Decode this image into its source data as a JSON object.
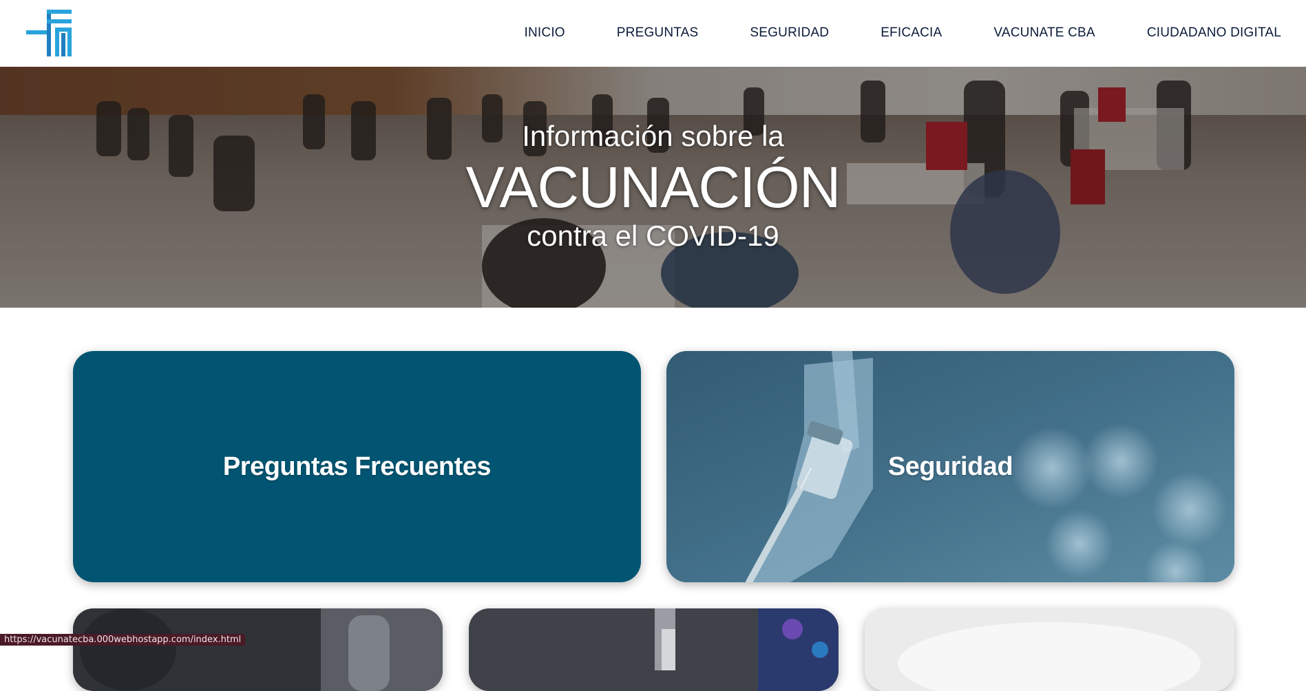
{
  "header": {
    "logo_name": "cf-monogram-logo",
    "logo_color": "#29a3dc",
    "nav": [
      {
        "label": "INICIO"
      },
      {
        "label": "PREGUNTAS"
      },
      {
        "label": "SEGURIDAD"
      },
      {
        "label": "EFICACIA"
      },
      {
        "label": "VACUNATE CBA"
      },
      {
        "label": "CIUDADANO DIGITAL"
      }
    ]
  },
  "hero": {
    "line1": "Información sobre la",
    "line2": "VACUNACIÓN",
    "line3": "contra el COVID-19"
  },
  "cards": {
    "faq": {
      "label": "Preguntas Frecuentes",
      "color": "#015572"
    },
    "seguridad": {
      "label": "Seguridad",
      "color": "#3d6a84"
    }
  },
  "status_bar": {
    "url": "https://vacunatecba.000webhostapp.com/index.html"
  }
}
